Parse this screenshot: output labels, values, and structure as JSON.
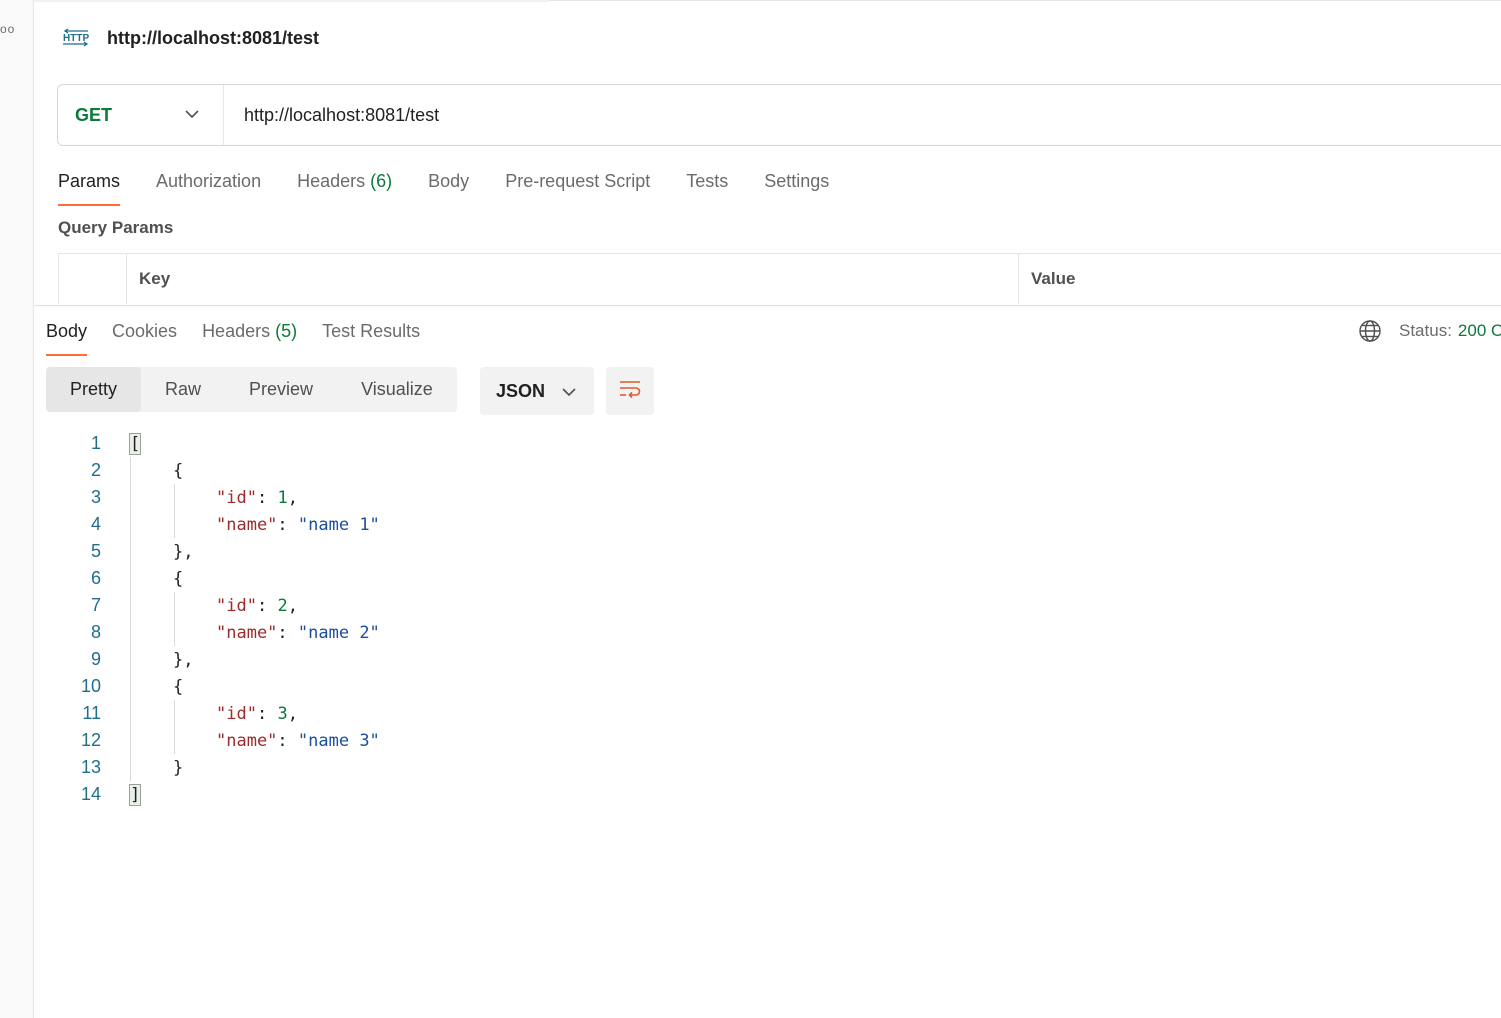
{
  "rail": {
    "dots": "oo"
  },
  "request": {
    "icon": "http-icon",
    "title": "http://localhost:8081/test",
    "method": "GET",
    "url": "http://localhost:8081/test"
  },
  "request_tabs": [
    {
      "label": "Params",
      "active": true
    },
    {
      "label": "Authorization"
    },
    {
      "label": "Headers",
      "count": "(6)"
    },
    {
      "label": "Body"
    },
    {
      "label": "Pre-request Script"
    },
    {
      "label": "Tests"
    },
    {
      "label": "Settings"
    }
  ],
  "query_params": {
    "title": "Query Params",
    "columns": [
      "Key",
      "Value"
    ]
  },
  "response_tabs": [
    {
      "label": "Body",
      "active": true
    },
    {
      "label": "Cookies"
    },
    {
      "label": "Headers",
      "count": "(5)"
    },
    {
      "label": "Test Results"
    }
  ],
  "status": {
    "label": "Status:",
    "value": "200 O"
  },
  "view_modes": [
    "Pretty",
    "Raw",
    "Preview",
    "Visualize"
  ],
  "format": "JSON",
  "code_lines": [
    {
      "n": "1",
      "text": "["
    },
    {
      "n": "2",
      "text": "{"
    },
    {
      "n": "3",
      "key": "\"id\"",
      "val": "1",
      "type": "num",
      "comma": ","
    },
    {
      "n": "4",
      "key": "\"name\"",
      "val": "\"name 1\"",
      "type": "str",
      "comma": ""
    },
    {
      "n": "5",
      "text": "},"
    },
    {
      "n": "6",
      "text": "{"
    },
    {
      "n": "7",
      "key": "\"id\"",
      "val": "2",
      "type": "num",
      "comma": ","
    },
    {
      "n": "8",
      "key": "\"name\"",
      "val": "\"name 2\"",
      "type": "str",
      "comma": ""
    },
    {
      "n": "9",
      "text": "},"
    },
    {
      "n": "10",
      "text": "{"
    },
    {
      "n": "11",
      "key": "\"id\"",
      "val": "3",
      "type": "num",
      "comma": ","
    },
    {
      "n": "12",
      "key": "\"name\"",
      "val": "\"name 3\"",
      "type": "str",
      "comma": ""
    },
    {
      "n": "13",
      "text": "}"
    },
    {
      "n": "14",
      "text": "]"
    }
  ],
  "colors": {
    "accent": "#ff6c37",
    "method_green": "#0b7a3b",
    "key_red": "#9c2b2b",
    "string_blue": "#1a4f9c"
  }
}
